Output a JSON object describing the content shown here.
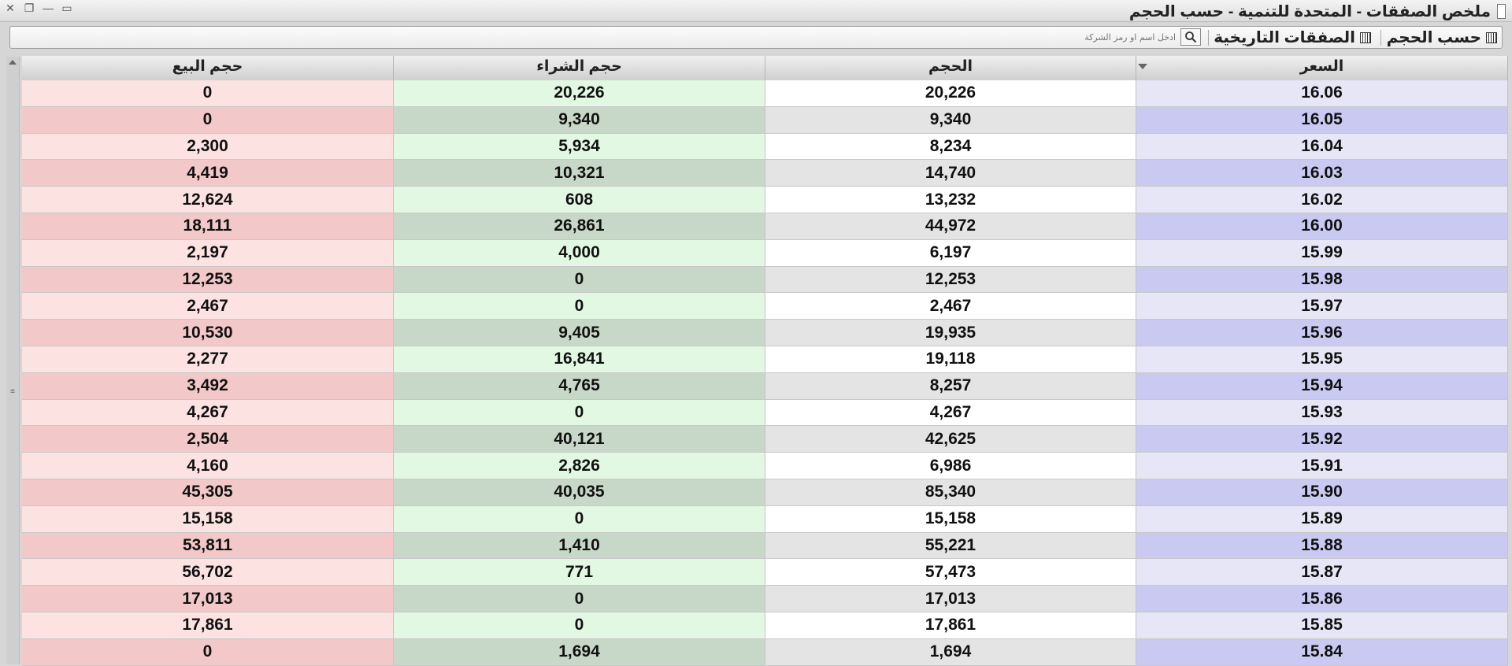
{
  "window": {
    "title": "ملخص الصفقات - المتحدة للتنمية - حسب الحجم",
    "controls": [
      "✕",
      "❐",
      "—",
      "▭"
    ]
  },
  "toolbar": {
    "by_volume_label": "حسب الحجم",
    "historical_label": "الصفقات التاريخية",
    "search_placeholder": "ادخل اسم او رمز الشركة"
  },
  "table": {
    "columns": [
      "السعر",
      "الحجم",
      "حجم الشراء",
      "حجم البيع"
    ],
    "rows": [
      [
        "16.06",
        "20,226",
        "20,226",
        "0"
      ],
      [
        "16.05",
        "9,340",
        "9,340",
        "0"
      ],
      [
        "16.04",
        "8,234",
        "5,934",
        "2,300"
      ],
      [
        "16.03",
        "14,740",
        "10,321",
        "4,419"
      ],
      [
        "16.02",
        "13,232",
        "608",
        "12,624"
      ],
      [
        "16.00",
        "44,972",
        "26,861",
        "18,111"
      ],
      [
        "15.99",
        "6,197",
        "4,000",
        "2,197"
      ],
      [
        "15.98",
        "12,253",
        "0",
        "12,253"
      ],
      [
        "15.97",
        "2,467",
        "0",
        "2,467"
      ],
      [
        "15.96",
        "19,935",
        "9,405",
        "10,530"
      ],
      [
        "15.95",
        "19,118",
        "16,841",
        "2,277"
      ],
      [
        "15.94",
        "8,257",
        "4,765",
        "3,492"
      ],
      [
        "15.93",
        "4,267",
        "0",
        "4,267"
      ],
      [
        "15.92",
        "42,625",
        "40,121",
        "2,504"
      ],
      [
        "15.91",
        "6,986",
        "2,826",
        "4,160"
      ],
      [
        "15.90",
        "85,340",
        "40,035",
        "45,305"
      ],
      [
        "15.89",
        "15,158",
        "0",
        "15,158"
      ],
      [
        "15.88",
        "55,221",
        "1,410",
        "53,811"
      ],
      [
        "15.87",
        "57,473",
        "771",
        "56,702"
      ],
      [
        "15.86",
        "17,013",
        "0",
        "17,013"
      ],
      [
        "15.85",
        "17,861",
        "0",
        "17,861"
      ],
      [
        "15.84",
        "1,694",
        "1,694",
        "0"
      ]
    ]
  },
  "colors": {
    "price_light": "#e6e6f6",
    "price_dark": "#c9c9f2",
    "volume_light": "#ffffff",
    "volume_dark": "#e4e4e4",
    "buy_light": "#e2f8e2",
    "buy_dark": "#c8d8c8",
    "sell_light": "#fde2e2",
    "sell_dark": "#f2c8c8"
  }
}
